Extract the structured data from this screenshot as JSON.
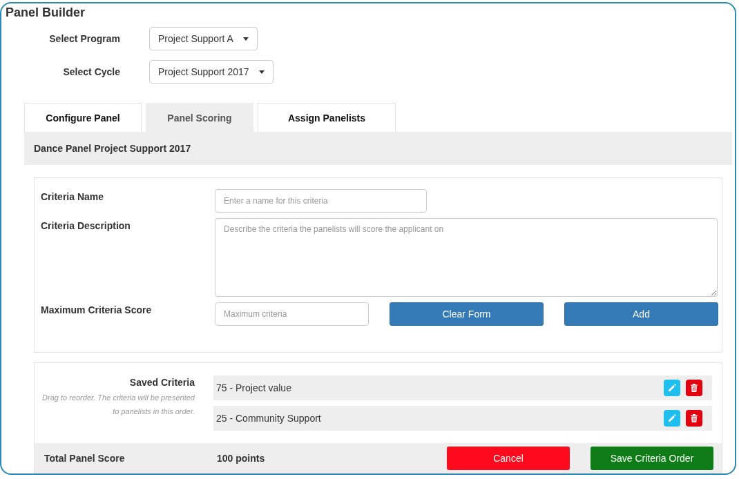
{
  "title": "Panel Builder",
  "selects": [
    {
      "label": "Select Program",
      "value": "Project Support A"
    },
    {
      "label": "Select Cycle",
      "value": "Project Support 2017"
    }
  ],
  "tabs": [
    {
      "label": "Configure Panel",
      "selected": false
    },
    {
      "label": "Panel Scoring",
      "selected": true
    },
    {
      "label": "Assign Panelists",
      "selected": false
    }
  ],
  "panel_heading": "Dance Panel Project Support 2017",
  "form": {
    "name_label": "Criteria Name",
    "name_placeholder": "Enter a name for this criteria",
    "description_label": "Criteria Description",
    "description_placeholder": "Describe the criteria the panelists will score the applicant on",
    "score_label": "Maximum Criteria Score",
    "score_placeholder": "Maximum criteria",
    "clear_button": "Clear Form",
    "add_button": "Add"
  },
  "saved": {
    "label": "Saved Criteria",
    "hint": "Drag to reorder. The criteria will be presented to panelists in this order.",
    "items": [
      {
        "text": "75 - Project value"
      },
      {
        "text": "25 - Community Support"
      }
    ]
  },
  "footer": {
    "label": "Total Panel Score",
    "total": "100 points",
    "cancel_button": "Cancel",
    "save_button": "Save Criteria Order"
  }
}
